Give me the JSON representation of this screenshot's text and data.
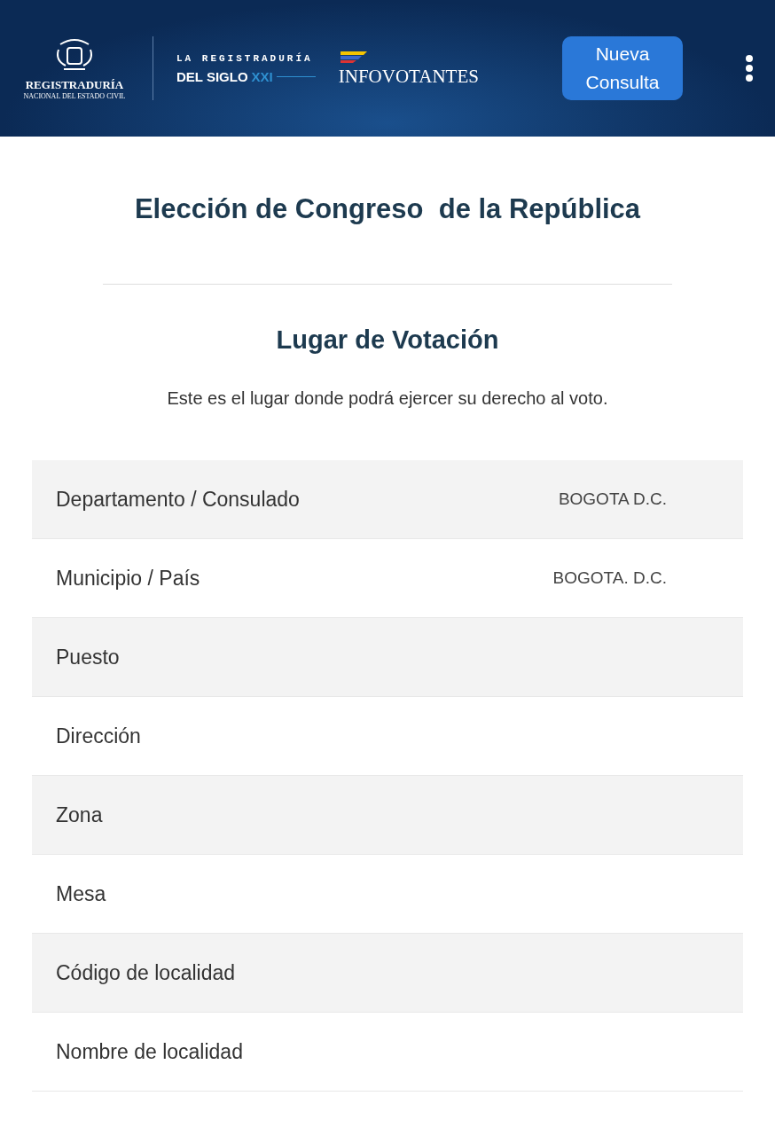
{
  "header": {
    "logo_title": "REGISTRADURÍA",
    "logo_subtitle": "NACIONAL DEL ESTADO CIVIL",
    "slogan_line1": "LA REGISTRADURÍA",
    "slogan_line2": "DEL SIGLO",
    "slogan_accent": "XXI",
    "app_name": "INFOVOTANTES",
    "button": "Nueva Consulta"
  },
  "title": "Elección de Congreso  de la República",
  "section_title": "Lugar de Votación",
  "description": "Este es el lugar donde podrá ejercer su derecho al voto.",
  "rows": [
    {
      "label": "Departamento / Consulado",
      "value": "BOGOTA D.C."
    },
    {
      "label": "Municipio / País",
      "value": "BOGOTA. D.C."
    },
    {
      "label": "Puesto"
    },
    {
      "label": "Dirección"
    },
    {
      "label": "Zona"
    },
    {
      "label": "Mesa"
    },
    {
      "label": "Código de localidad"
    },
    {
      "label": "Nombre de localidad"
    }
  ]
}
